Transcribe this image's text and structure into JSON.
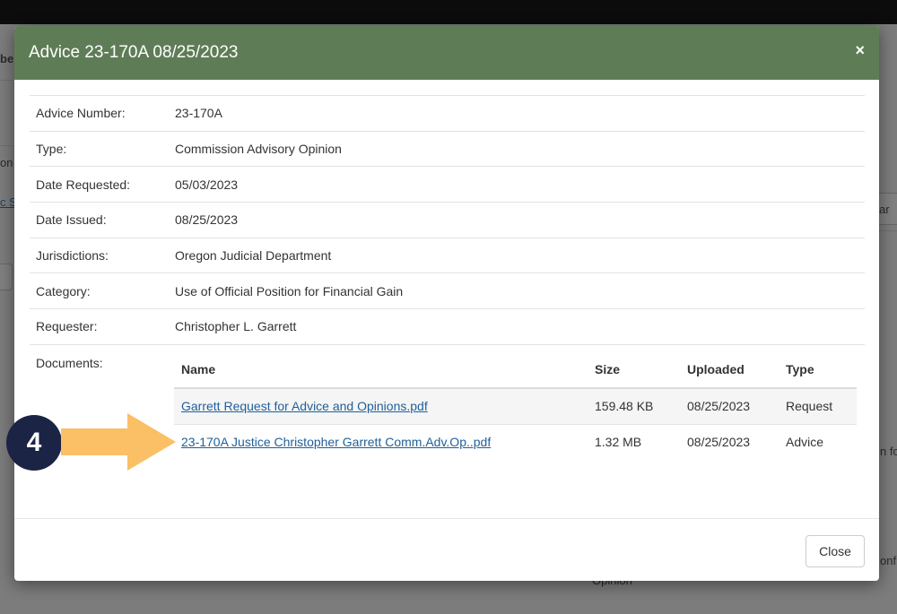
{
  "background": {
    "fragments": [
      "be",
      "on",
      "c S",
      "ar",
      "n fo",
      "onfli",
      "Opinion"
    ]
  },
  "modal": {
    "title": "Advice 23-170A 08/25/2023",
    "close_icon": "×",
    "details": [
      {
        "label": "Advice Number:",
        "value": "23-170A"
      },
      {
        "label": "Type:",
        "value": "Commission Advisory Opinion"
      },
      {
        "label": "Date Requested:",
        "value": "05/03/2023"
      },
      {
        "label": "Date Issued:",
        "value": "08/25/2023"
      },
      {
        "label": "Jurisdictions:",
        "value": "Oregon Judicial Department"
      },
      {
        "label": "Category:",
        "value": "Use of Official Position for Financial Gain"
      },
      {
        "label": "Requester:",
        "value": "Christopher L. Garrett"
      }
    ],
    "documents_label": "Documents:",
    "documents": {
      "columns": [
        "Name",
        "Size",
        "Uploaded",
        "Type"
      ],
      "rows": [
        {
          "name": "Garrett Request for Advice and Opinions.pdf",
          "size": "159.48 KB",
          "uploaded": "08/25/2023",
          "type": "Request"
        },
        {
          "name": "23-170A Justice Christopher Garrett Comm.Adv.Op..pdf",
          "size": "1.32 MB",
          "uploaded": "08/25/2023",
          "type": "Advice"
        }
      ]
    },
    "footer": {
      "close_label": "Close"
    }
  },
  "annotation": {
    "step_number": "4",
    "badge_color": "#1b2445",
    "arrow_color": "#fbbf66"
  },
  "colors": {
    "header_bg": "#5e7d56",
    "link": "#1f5f9a"
  }
}
